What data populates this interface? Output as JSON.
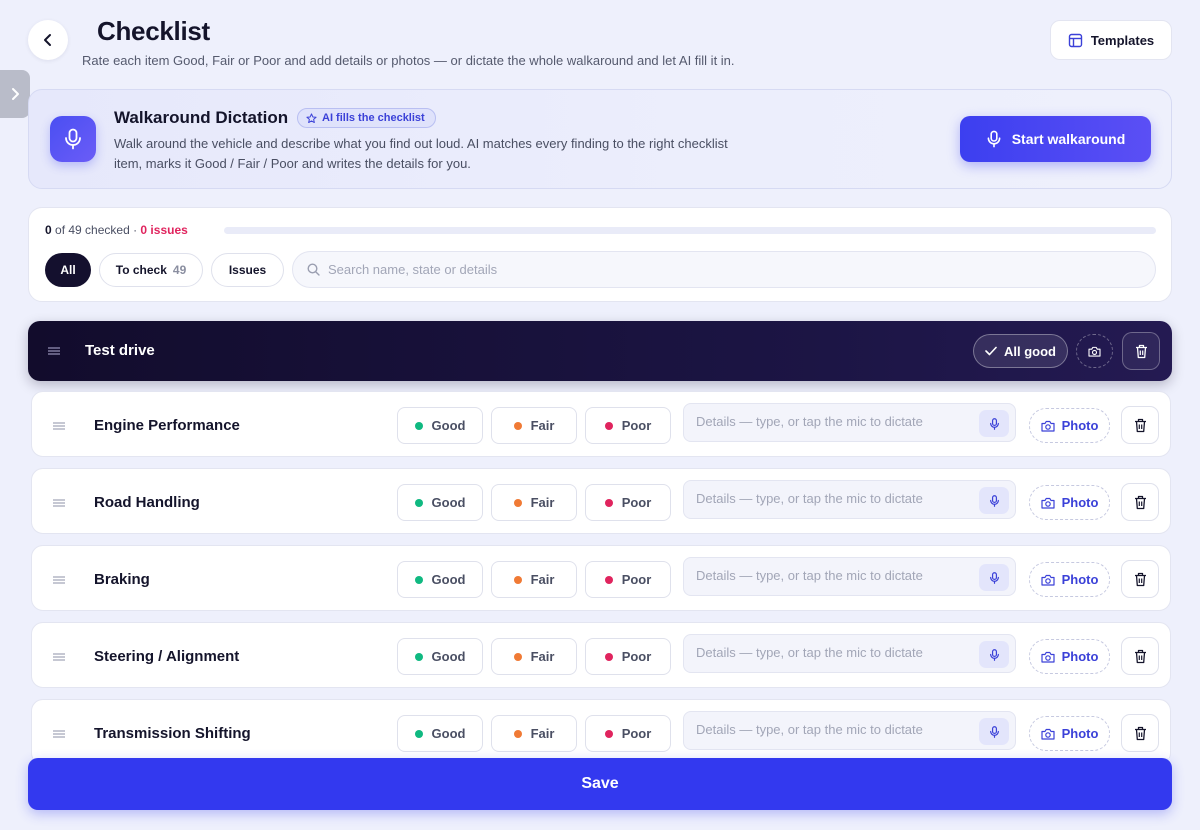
{
  "header": {
    "title": "Checklist",
    "subtitle": "Rate each item Good, Fair or Poor and add details or photos — or dictate the whole walkaround and let AI fill it in.",
    "templates_label": "Templates"
  },
  "dictation": {
    "title": "Walkaround Dictation",
    "badge": "AI fills the checklist",
    "description": "Walk around the vehicle and describe what you find out loud. AI matches every finding to the right checklist item, marks it Good / Fair / Poor and writes the details for you.",
    "start_label": "Start walkaround"
  },
  "progress": {
    "checked": "0",
    "of_total": " of 49 checked",
    "separator": " · ",
    "issues": "0 issues",
    "fraction": 0
  },
  "filters": {
    "all": "All",
    "to_check": "To check",
    "to_check_count": "49",
    "issues": "Issues"
  },
  "search": {
    "placeholder": "Search name, state or details",
    "value": ""
  },
  "section": {
    "title": "Test drive",
    "all_good_label": "All good"
  },
  "states": {
    "good": "Good",
    "fair": "Fair",
    "poor": "Poor"
  },
  "details_placeholder": "Details — type, or tap the mic to dictate",
  "photo_label": "Photo",
  "items": [
    {
      "name": "Engine Performance"
    },
    {
      "name": "Road Handling"
    },
    {
      "name": "Braking"
    },
    {
      "name": "Steering / Alignment"
    },
    {
      "name": "Transmission Shifting"
    }
  ],
  "footer": {
    "save_label": "Save"
  },
  "colors": {
    "accent": "#3339ef",
    "good": "#10b981",
    "fair": "#f07a35",
    "poor": "#e0245e",
    "dark": "#14102e"
  }
}
